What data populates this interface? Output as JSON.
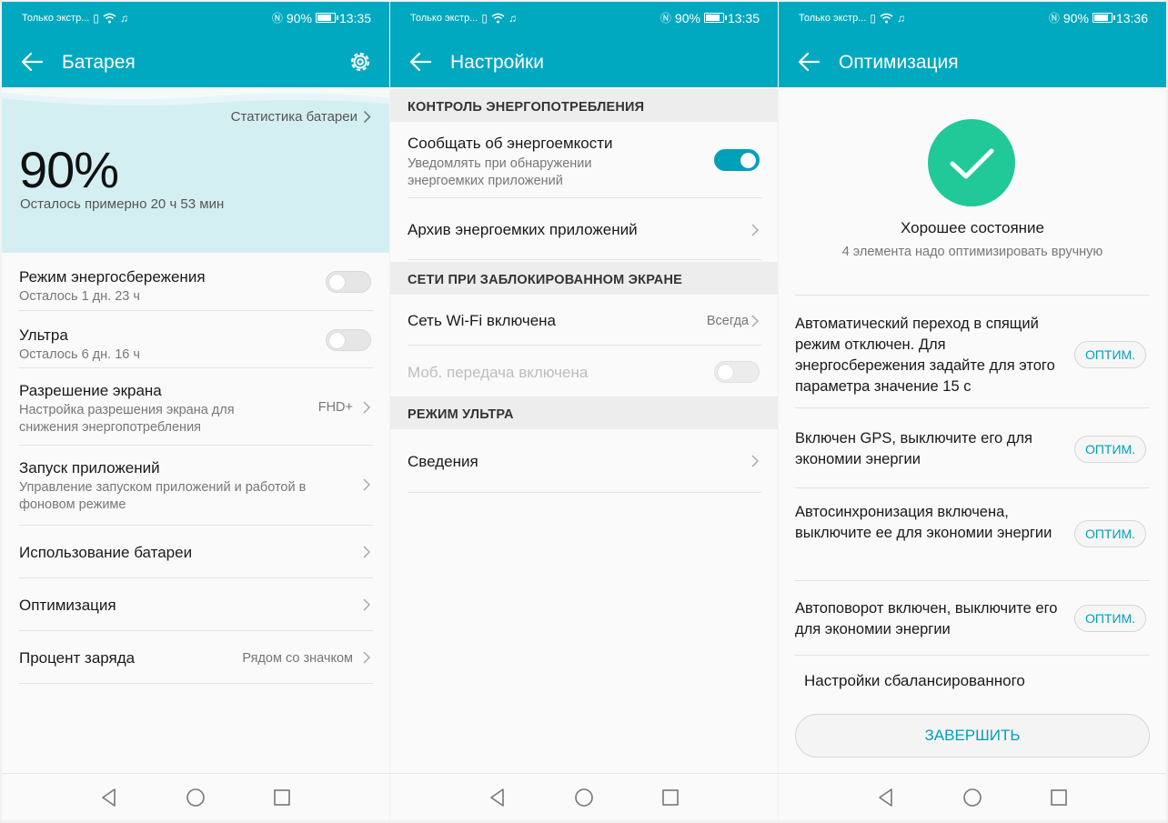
{
  "colors": {
    "accent": "#00a8c0",
    "success": "#20c997",
    "hero_bg": "#d4eff2"
  },
  "statusbar": [
    {
      "notice": "Только экстр...",
      "battery_pct": "90%",
      "time": "13:35"
    },
    {
      "notice": "Только экстр...",
      "battery_pct": "90%",
      "time": "13:35"
    },
    {
      "notice": "Только экстр...",
      "battery_pct": "90%",
      "time": "13:36"
    }
  ],
  "screen1": {
    "title": "Батарея",
    "stats_link": "Статистика батареи",
    "percent": "90%",
    "remaining": "Осталось примерно 20 ч 53 мин",
    "items": [
      {
        "title": "Режим энергосбережения",
        "sub": "Осталось 1 дн. 23 ч",
        "toggle": false
      },
      {
        "title": "Ультра",
        "sub": "Осталось 6 дн. 16 ч",
        "toggle": false
      },
      {
        "title": "Разрешение экрана",
        "sub": "Настройка разрешения экрана для снижения энергопотребления",
        "value": "FHD+"
      },
      {
        "title": "Запуск приложений",
        "sub": "Управление запуском приложений и работой в фоновом режиме"
      },
      {
        "title": "Использование батареи"
      },
      {
        "title": "Оптимизация"
      },
      {
        "title": "Процент заряда",
        "value": "Рядом со значком"
      }
    ]
  },
  "screen2": {
    "title": "Настройки",
    "section1": "КОНТРОЛЬ ЭНЕРГОПОТРЕБЛЕНИЯ",
    "notify_title": "Сообщать об энергоемкости",
    "notify_sub": "Уведомлять при обнаружении энергоемких приложений",
    "notify_toggle": true,
    "archive": "Архив энергоемких приложений",
    "section2": "СЕТИ ПРИ ЗАБЛОКИРОВАННОМ ЭКРАНЕ",
    "wifi_title": "Сеть Wi-Fi включена",
    "wifi_value": "Всегда",
    "mobile_title": "Моб. передача включена",
    "mobile_toggle": false,
    "section3": "РЕЖИМ УЛЬТРА",
    "details": "Сведения"
  },
  "screen3": {
    "title": "Оптимизация",
    "status_title": "Хорошее состояние",
    "status_sub": "4 элемента надо оптимизировать вручную",
    "items": [
      {
        "text": "Автоматический переход в спящий режим отключен. Для энергосбережения задайте для этого параметра значение 15 с",
        "button": "ОПТИМ."
      },
      {
        "text": "Включен GPS, выключите его для экономии энергии",
        "button": "ОПТИМ."
      },
      {
        "text": "Автосинхронизация включена, выключите ее для экономии энергии",
        "button": "ОПТИМ."
      },
      {
        "text": "Автоповорот включен, выключите его для экономии энергии",
        "button": "ОПТИМ."
      }
    ],
    "partial_item": "Настройки сбалансированного",
    "finish": "ЗАВЕРШИТЬ"
  }
}
